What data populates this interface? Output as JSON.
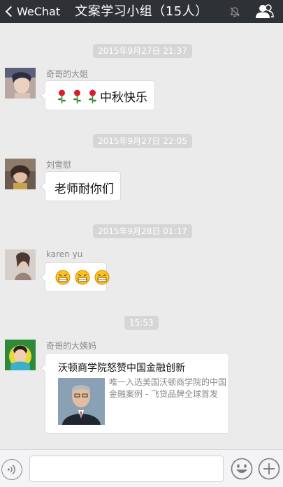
{
  "navbar": {
    "back_label": "WeChat",
    "title": "文案学习小组（15人）",
    "mute_icon": "mute-bell-icon",
    "group_icon": "group-members-icon"
  },
  "colors": {
    "navbar": "#2e3135",
    "chat_background": "#ebebeb",
    "timestamp_pill": "#d6d6d6",
    "bubble": "#ffffff"
  },
  "messages": [
    {
      "timestamp": "2015年9月27日 21:37",
      "sender": "奇哥的大姐",
      "text": "中秋快乐",
      "emoji": [
        "rose-icon",
        "rose-icon",
        "rose-icon"
      ]
    },
    {
      "timestamp": "2015年9月27日 22:05",
      "sender": "刘雪慰",
      "text": "老师耐你们"
    },
    {
      "timestamp": "2015年9月28日 01:17",
      "sender": "karen yu",
      "emoji": [
        "grin-emoji-icon",
        "grin-emoji-icon",
        "grin-emoji-icon"
      ]
    },
    {
      "timestamp": "15:53",
      "sender": "奇哥的大姨妈",
      "card": {
        "title": "沃顿商学院怒赞中国金融创新",
        "description": "唯一入选美国沃顿商学院的中国金融案例 - 飞贷品牌全球首发",
        "thumbnail_icon": "article-thumbnail"
      }
    }
  ],
  "input_bar": {
    "voice_icon": "voice-icon",
    "text_value": "",
    "emoji_icon": "emoji-icon",
    "plus_icon": "plus-icon"
  }
}
